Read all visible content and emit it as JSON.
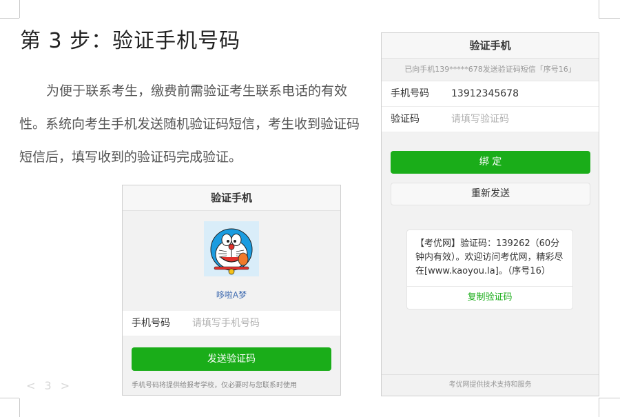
{
  "page": {
    "title": "第 3 步：验证手机号码",
    "paragraph": "为便于联系考生，缴费前需验证考生联系电话的有效性。系统向考生手机发送随机验证码短信，考生收到验证码短信后，填写收到的验证码完成验证。",
    "page_number": "< 3 >"
  },
  "phone1": {
    "header": "验证手机",
    "nickname": "哆啦A梦",
    "phone_label": "手机号码",
    "phone_placeholder": "请填写手机号码",
    "send_button": "发送验证码",
    "note": "手机号码将提供给报考学校，仅必要时与您联系时使用"
  },
  "phone2": {
    "header": "验证手机",
    "sent_info": "已向手机139*****678发送验证码短信「序号16」",
    "phone_label": "手机号码",
    "phone_value": "13912345678",
    "code_label": "验证码",
    "code_placeholder": "请填写验证码",
    "bind_button": "绑 定",
    "resend_button": "重新发送",
    "sms_text": "【考优网】验证码：139262（60分钟内有效）。欢迎访问考优网，精彩尽在[www.kaoyou.la]。（序号16）",
    "copy_button": "复制验证码",
    "footer": "考优网提供技术支持和服务"
  },
  "colors": {
    "accent_green": "#1aad19",
    "nickname_blue": "#3f6bb0"
  }
}
